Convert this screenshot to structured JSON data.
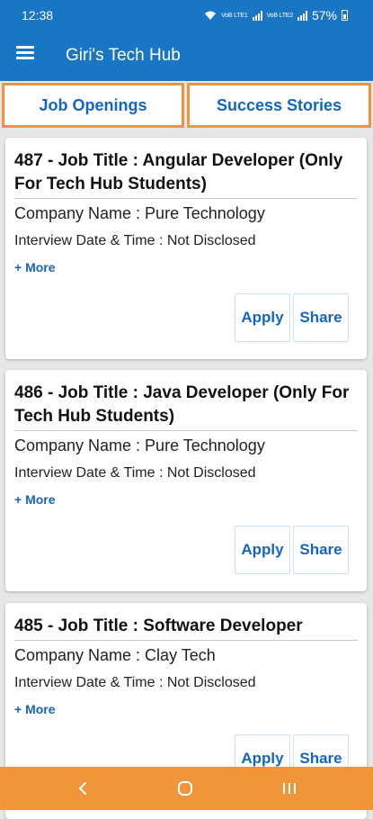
{
  "status_bar": {
    "time": "12:38",
    "signal_text_1": "VoB LTE1",
    "signal_text_2": "VoB LTE2",
    "battery": "57%"
  },
  "app_bar": {
    "title": "Giri's Tech Hub",
    "menu_icon": "hamburger-menu-icon"
  },
  "tabs": [
    {
      "label": "Job Openings",
      "selected": true
    },
    {
      "label": "Success Stories",
      "selected": false
    }
  ],
  "jobs": [
    {
      "title": "487 - Job Title : Angular Developer (Only For Tech Hub Students)",
      "company": "Company Name :  Pure Technology",
      "interview": "Interview Date & Time : Not Disclosed",
      "more": "+ More",
      "apply": "Apply",
      "share": "Share"
    },
    {
      "title": "486 - Job Title : Java Developer (Only For Tech Hub Students)",
      "company": "Company Name :  Pure Technology",
      "interview": "Interview Date & Time : Not Disclosed",
      "more": "+ More",
      "apply": "Apply",
      "share": "Share"
    },
    {
      "title": "485 - Job Title : Software Developer",
      "company": "Company Name : Clay Tech",
      "interview": "Interview Date & Time : Not Disclosed",
      "more": "+ More",
      "apply": "Apply",
      "share": "Share"
    }
  ],
  "colors": {
    "primary": "#1976c5",
    "accent": "#f0953a",
    "link": "#1565c0"
  },
  "nav_bar": {
    "icons": [
      "back-icon",
      "home-icon",
      "recent-apps-icon"
    ]
  }
}
